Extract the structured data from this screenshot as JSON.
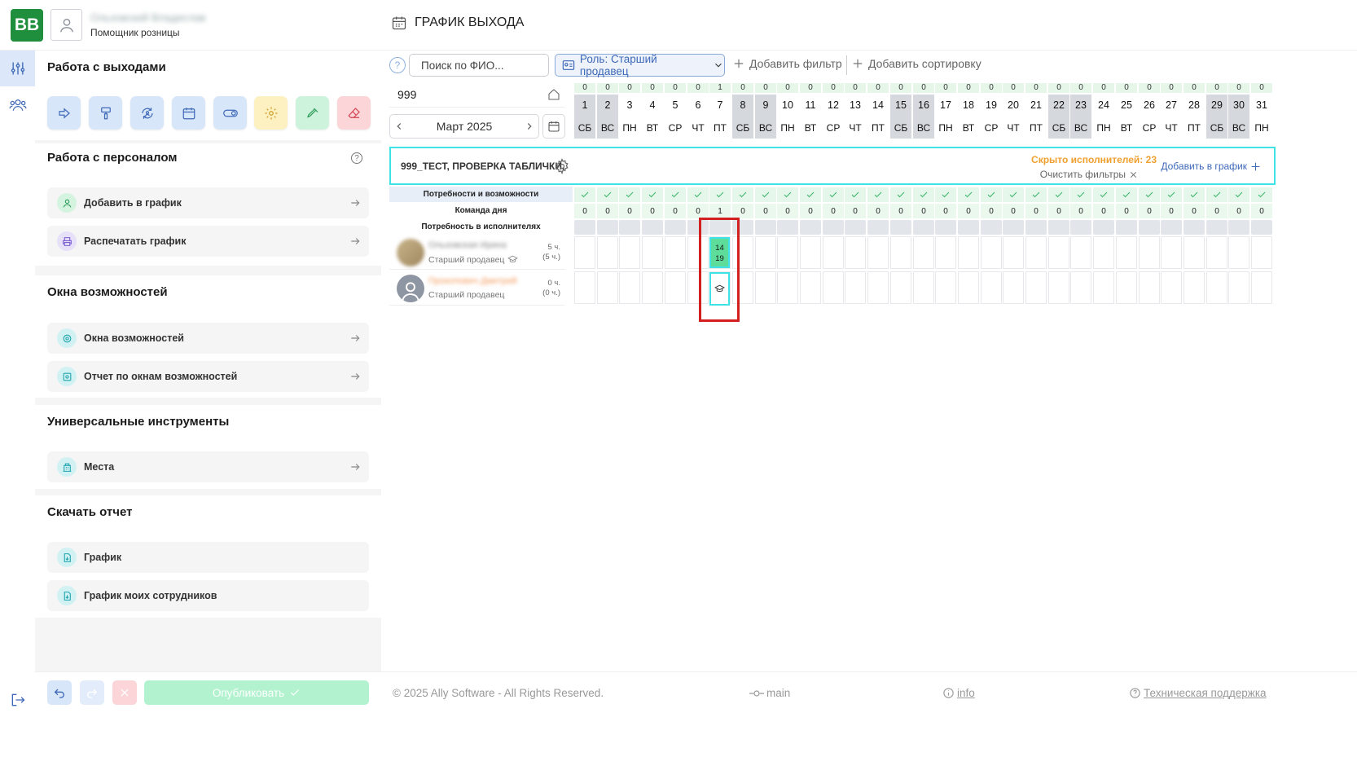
{
  "app": {
    "logo": "BB",
    "user_name": "Ольховский Владислав",
    "user_role": "Помощник розницы",
    "page_title": "ГРАФИК ВЫХОДА"
  },
  "sidebar": {
    "section1": "Работа с выходами",
    "tools": [
      "export-icon",
      "paint-roller-icon",
      "refresh-user-icon",
      "calendar-icon",
      "toggle-icon",
      "gear-icon",
      "pipette-icon",
      "eraser-icon"
    ],
    "section2": "Работа с персоналом",
    "section2_items": [
      {
        "label": "Добавить в график",
        "icon": "user-icon"
      },
      {
        "label": "Распечатать график",
        "icon": "printer-icon"
      }
    ],
    "section3": "Окна возможностей",
    "section3_items": [
      {
        "label": "Окна возможностей",
        "icon": "window-icon"
      },
      {
        "label": "Отчет по окнам возможностей",
        "icon": "report-icon"
      }
    ],
    "section4": "Универсальные инструменты",
    "section4_items": [
      {
        "label": "Места",
        "icon": "building-icon"
      }
    ],
    "section5": "Скачать отчет",
    "section5_items": [
      {
        "label": "График",
        "icon": "download-file-icon"
      },
      {
        "label": "График моих сотрудников",
        "icon": "download-file-icon"
      }
    ]
  },
  "toolbar": {
    "help": "?",
    "search_placeholder": "Поиск по ФИО...",
    "role_filter": "Роль: Старший продавец",
    "add_filter": "Добавить фильтр",
    "add_sort": "Добавить сортировку"
  },
  "calendar": {
    "store_code": "999",
    "month": "Март 2025",
    "counts": [
      "0",
      "0",
      "0",
      "0",
      "0",
      "0",
      "1",
      "0",
      "0",
      "0",
      "0",
      "0",
      "0",
      "0",
      "0",
      "0",
      "0",
      "0",
      "0",
      "0",
      "0",
      "0",
      "0",
      "0",
      "0",
      "0",
      "0",
      "0",
      "0",
      "0",
      "0"
    ],
    "days": [
      "1",
      "2",
      "3",
      "4",
      "5",
      "6",
      "7",
      "8",
      "9",
      "10",
      "11",
      "12",
      "13",
      "14",
      "15",
      "16",
      "17",
      "18",
      "19",
      "20",
      "21",
      "22",
      "23",
      "24",
      "25",
      "26",
      "27",
      "28",
      "29",
      "30",
      "31"
    ],
    "weekdays": [
      "СБ",
      "ВС",
      "ПН",
      "ВТ",
      "СР",
      "ЧТ",
      "ПТ",
      "СБ",
      "ВС",
      "ПН",
      "ВТ",
      "СР",
      "ЧТ",
      "ПТ",
      "СБ",
      "ВС",
      "ПН",
      "ВТ",
      "СР",
      "ЧТ",
      "ПТ",
      "СБ",
      "ВС",
      "ПН",
      "ВТ",
      "СР",
      "ЧТ",
      "ПТ",
      "СБ",
      "ВС",
      "ПН"
    ],
    "weekend_days": [
      1,
      2,
      8,
      9,
      15,
      16,
      22,
      23,
      29,
      30
    ]
  },
  "store": {
    "name": "999_ТЕСТ, ПРОВЕРКА ТАБЛИЧКИ.",
    "hidden": "Скрыто исполнителей: 23",
    "clear_filters": "Очистить фильтры",
    "add_to_schedule": "Добавить в график"
  },
  "stats": {
    "row1_label": "Потребности и возможности",
    "row2_label": "Команда дня",
    "row3_label": "Потребность в исполнителях",
    "team_counts": [
      "0",
      "0",
      "0",
      "0",
      "0",
      "0",
      "1",
      "0",
      "0",
      "0",
      "0",
      "0",
      "0",
      "0",
      "0",
      "0",
      "0",
      "0",
      "0",
      "0",
      "0",
      "0",
      "0",
      "0",
      "0",
      "0",
      "0",
      "0",
      "0",
      "0",
      "0"
    ]
  },
  "employees": [
    {
      "name": "Ольховская Ирина",
      "role": "Старший продавец",
      "hours": "5 ч.",
      "hours_sub": "(5 ч.)"
    },
    {
      "name": "Прокопович Дмитрий",
      "role": "Старший продавец",
      "hours": "0 ч.",
      "hours_sub": "(0 ч.)"
    }
  ],
  "shift": {
    "start": "14",
    "end": "19"
  },
  "footer": {
    "publish": "Опубликовать",
    "copyright": "© 2025 Ally Software - All Rights Reserved.",
    "branch": "main",
    "info": "info",
    "support": "Техническая поддержка"
  },
  "colors": {
    "brand_green": "#1f8e3d",
    "accent_blue": "#3d68b8",
    "cyan_highlight": "#3fe3e6",
    "red_highlight": "#d21f1f",
    "shift_green": "#5ddc9a",
    "warning_orange": "#f0a030"
  }
}
